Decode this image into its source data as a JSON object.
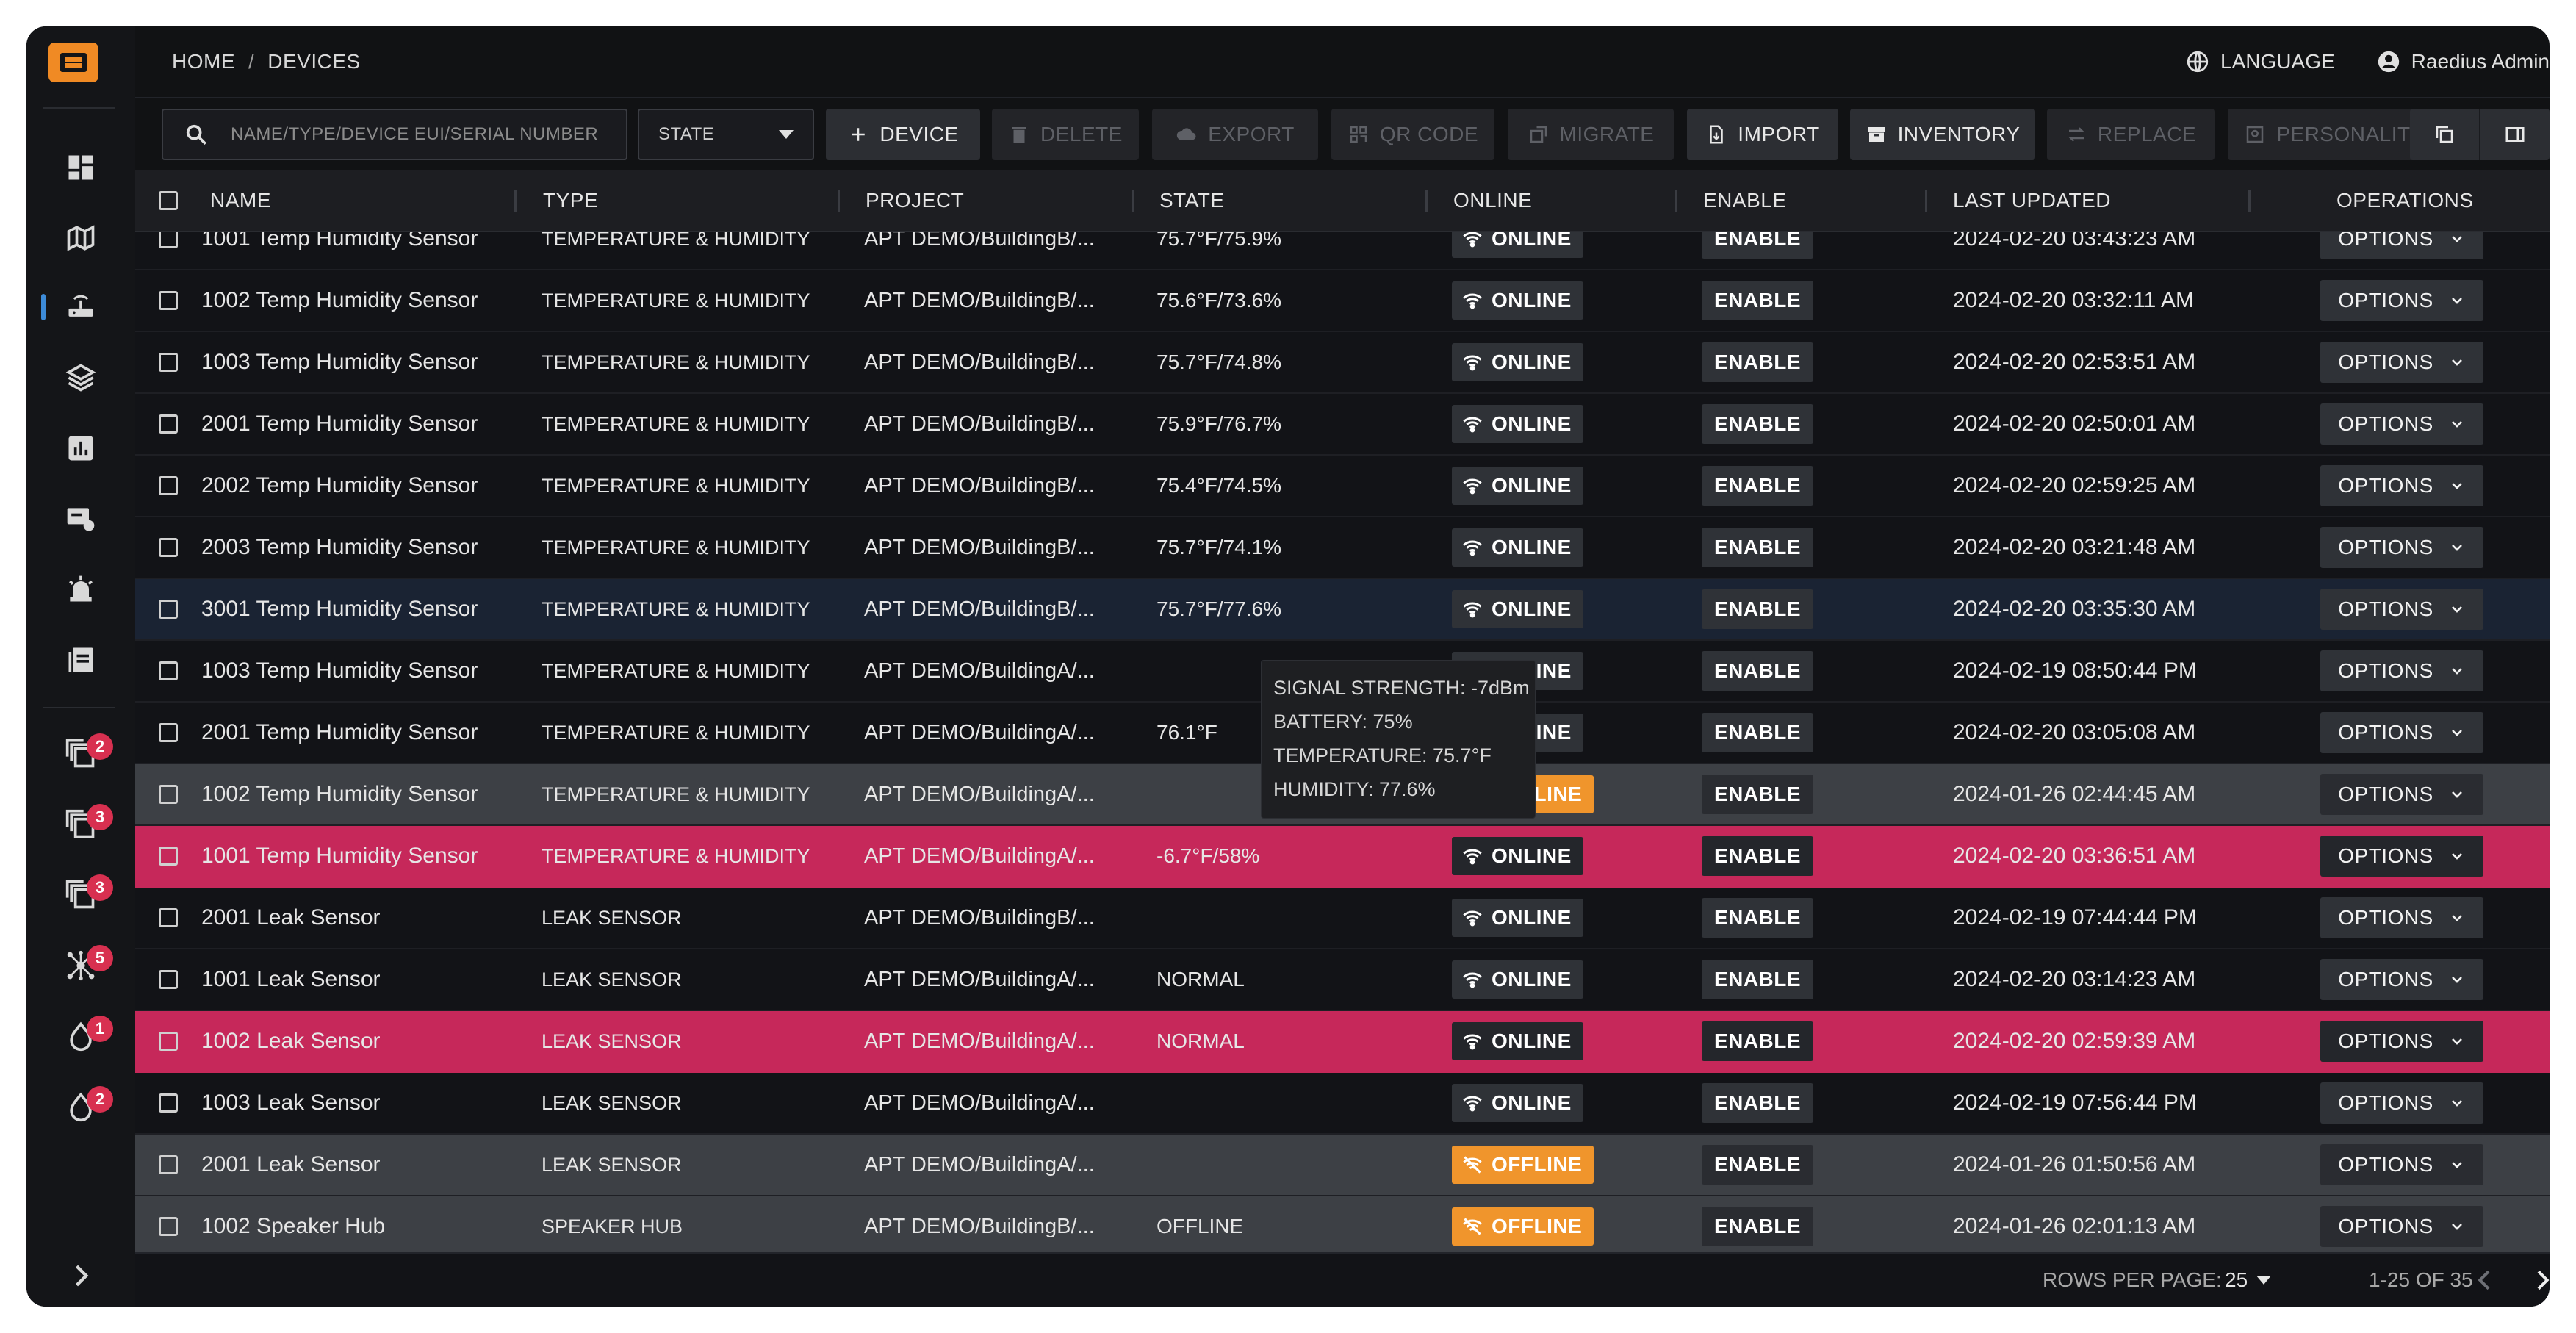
{
  "breadcrumb": {
    "home": "HOME",
    "sep": "/",
    "current": "DEVICES"
  },
  "header": {
    "language": "LANGUAGE",
    "user": "Raedius Admin"
  },
  "toolbar": {
    "search_placeholder": "NAME/TYPE/DEVICE EUI/SERIAL NUMBER",
    "state_select": "STATE",
    "device": "DEVICE",
    "delete": "DELETE",
    "export": "EXPORT",
    "qr_code": "QR CODE",
    "migrate": "MIGRATE",
    "import": "IMPORT",
    "inventory": "INVENTORY",
    "replace": "REPLACE",
    "personality": "PERSONALITY"
  },
  "sidebar": {
    "badges": [
      "2",
      "3",
      "3",
      "5",
      "1",
      "2"
    ]
  },
  "columns": {
    "name": "NAME",
    "type": "TYPE",
    "project": "PROJECT",
    "state": "STATE",
    "online": "ONLINE",
    "enable": "ENABLE",
    "last_updated": "LAST UPDATED",
    "operations": "OPERATIONS"
  },
  "rows": [
    {
      "name": "1001 Temp Humidity Sensor",
      "type": "TEMPERATURE & HUMIDITY S",
      "project": "APT DEMO/BuildingB/...",
      "state": "75.7°F/75.9%",
      "online": "ONLINE",
      "enable": "ENABLE",
      "updated": "2024-02-20 03:43:23 AM",
      "ops": "OPTIONS"
    },
    {
      "name": "1002 Temp Humidity Sensor",
      "type": "TEMPERATURE & HUMIDITY S",
      "project": "APT DEMO/BuildingB/...",
      "state": "75.6°F/73.6%",
      "online": "ONLINE",
      "enable": "ENABLE",
      "updated": "2024-02-20 03:32:11 AM",
      "ops": "OPTIONS"
    },
    {
      "name": "1003 Temp Humidity Sensor",
      "type": "TEMPERATURE & HUMIDITY S",
      "project": "APT DEMO/BuildingB/...",
      "state": "75.7°F/74.8%",
      "online": "ONLINE",
      "enable": "ENABLE",
      "updated": "2024-02-20 02:53:51 AM",
      "ops": "OPTIONS"
    },
    {
      "name": "2001 Temp Humidity Sensor",
      "type": "TEMPERATURE & HUMIDITY S",
      "project": "APT DEMO/BuildingB/...",
      "state": "75.9°F/76.7%",
      "online": "ONLINE",
      "enable": "ENABLE",
      "updated": "2024-02-20 02:50:01 AM",
      "ops": "OPTIONS"
    },
    {
      "name": "2002 Temp Humidity Sensor",
      "type": "TEMPERATURE & HUMIDITY S",
      "project": "APT DEMO/BuildingB/...",
      "state": "75.4°F/74.5%",
      "online": "ONLINE",
      "enable": "ENABLE",
      "updated": "2024-02-20 02:59:25 AM",
      "ops": "OPTIONS"
    },
    {
      "name": "2003 Temp Humidity Sensor",
      "type": "TEMPERATURE & HUMIDITY S",
      "project": "APT DEMO/BuildingB/...",
      "state": "75.7°F/74.1%",
      "online": "ONLINE",
      "enable": "ENABLE",
      "updated": "2024-02-20 03:21:48 AM",
      "ops": "OPTIONS"
    },
    {
      "name": "3001 Temp Humidity Sensor",
      "type": "TEMPERATURE & HUMIDITY S",
      "project": "APT DEMO/BuildingB/...",
      "state": "75.7°F/77.6%",
      "online": "ONLINE",
      "enable": "ENABLE",
      "updated": "2024-02-20 03:35:30 AM",
      "ops": "OPTIONS"
    },
    {
      "name": "1003 Temp Humidity Sensor",
      "type": "TEMPERATURE & HUMIDITY S",
      "project": "APT DEMO/BuildingA/...",
      "state": "",
      "online": "ONLINE",
      "enable": "ENABLE",
      "updated": "2024-02-19 08:50:44 PM",
      "ops": "OPTIONS"
    },
    {
      "name": "2001 Temp Humidity Sensor",
      "type": "TEMPERATURE & HUMIDITY S",
      "project": "APT DEMO/BuildingA/...",
      "state": "76.1°F",
      "online": "ONLINE",
      "enable": "ENABLE",
      "updated": "2024-02-20 03:05:08 AM",
      "ops": "OPTIONS"
    },
    {
      "name": "1002 Temp Humidity Sensor",
      "type": "TEMPERATURE & HUMIDITY S",
      "project": "APT DEMO/BuildingA/...",
      "state": "",
      "online": "OFFLINE",
      "enable": "ENABLE",
      "updated": "2024-01-26 02:44:45 AM",
      "ops": "OPTIONS"
    },
    {
      "name": "1001 Temp Humidity Sensor",
      "type": "TEMPERATURE & HUMIDITY S",
      "project": "APT DEMO/BuildingA/...",
      "state": "-6.7°F/58%",
      "online": "ONLINE",
      "enable": "ENABLE",
      "updated": "2024-02-20 03:36:51 AM",
      "ops": "OPTIONS"
    },
    {
      "name": "2001 Leak Sensor",
      "type": "LEAK SENSOR",
      "project": "APT DEMO/BuildingB/...",
      "state": "",
      "online": "ONLINE",
      "enable": "ENABLE",
      "updated": "2024-02-19 07:44:44 PM",
      "ops": "OPTIONS"
    },
    {
      "name": "1001 Leak Sensor",
      "type": "LEAK SENSOR",
      "project": "APT DEMO/BuildingA/...",
      "state": "NORMAL",
      "online": "ONLINE",
      "enable": "ENABLE",
      "updated": "2024-02-20 03:14:23 AM",
      "ops": "OPTIONS"
    },
    {
      "name": "1002 Leak Sensor",
      "type": "LEAK SENSOR",
      "project": "APT DEMO/BuildingA/...",
      "state": "NORMAL",
      "online": "ONLINE",
      "enable": "ENABLE",
      "updated": "2024-02-20 02:59:39 AM",
      "ops": "OPTIONS"
    },
    {
      "name": "1003 Leak Sensor",
      "type": "LEAK SENSOR",
      "project": "APT DEMO/BuildingA/...",
      "state": "",
      "online": "ONLINE",
      "enable": "ENABLE",
      "updated": "2024-02-19 07:56:44 PM",
      "ops": "OPTIONS"
    },
    {
      "name": "2001 Leak Sensor",
      "type": "LEAK SENSOR",
      "project": "APT DEMO/BuildingA/...",
      "state": "",
      "online": "OFFLINE",
      "enable": "ENABLE",
      "updated": "2024-01-26 01:50:56 AM",
      "ops": "OPTIONS"
    },
    {
      "name": "1002 Speaker Hub",
      "type": "SPEAKER HUB",
      "project": "APT DEMO/BuildingB/...",
      "state": "OFFLINE",
      "online": "OFFLINE",
      "enable": "ENABLE",
      "updated": "2024-01-26 02:01:13 AM",
      "ops": "OPTIONS"
    }
  ],
  "tooltip": {
    "signal": "SIGNAL STRENGTH: -7dBm",
    "battery": "BATTERY: 75%",
    "temperature": "TEMPERATURE: 75.7°F",
    "humidity": "HUMIDITY: 77.6%"
  },
  "footer": {
    "rows_per_page_label": "ROWS PER PAGE:",
    "rows_per_page": "25",
    "range": "1-25 OF 35"
  },
  "colors": {
    "accent": "#3d8bd8",
    "alert_row": "#c6285a",
    "offline": "#f0952c",
    "badge": "#d83050"
  }
}
